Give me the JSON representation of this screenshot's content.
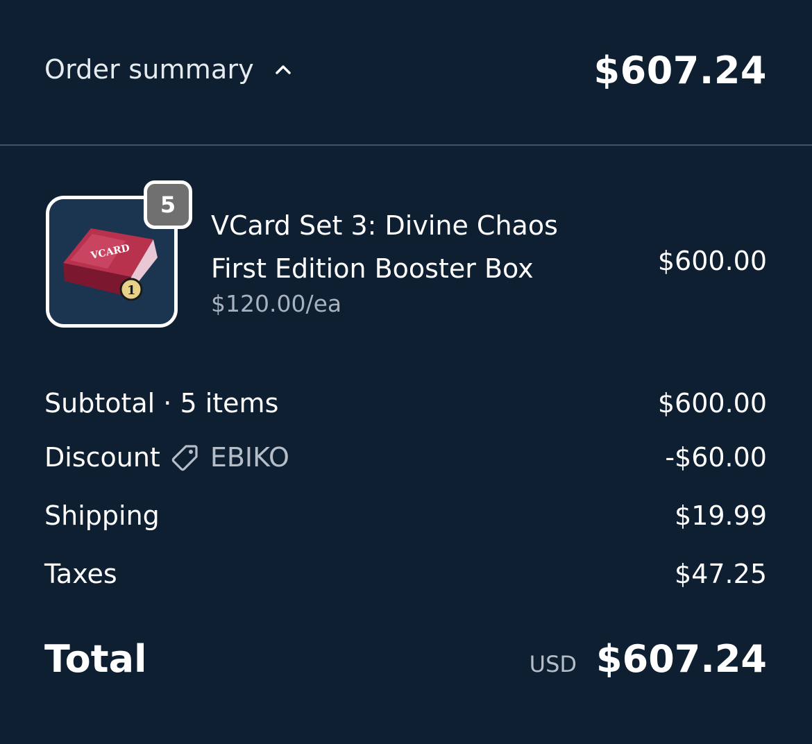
{
  "header": {
    "summary_label": "Order summary",
    "total": "$607.24"
  },
  "item": {
    "quantity": "5",
    "title_line1": "VCard Set 3: Divine Chaos",
    "title_line2": "First Edition Booster Box",
    "unit_price": "$120.00/ea",
    "line_price": "$600.00",
    "image_text": "VCARD"
  },
  "summary": {
    "subtotal_label": "Subtotal · 5 items",
    "subtotal_value": "$600.00",
    "discount_label": "Discount",
    "discount_code": "EBIKO",
    "discount_value": "-$60.00",
    "shipping_label": "Shipping",
    "shipping_value": "$19.99",
    "taxes_label": "Taxes",
    "taxes_value": "$47.25"
  },
  "total": {
    "label": "Total",
    "currency": "USD",
    "value": "$607.24"
  },
  "colors": {
    "background": "#0e1f31",
    "divider": "#43536a",
    "muted_text": "#a8b2be",
    "badge": "#707070"
  },
  "icons": {
    "toggle": "chevron-up-icon",
    "discount": "tag-icon"
  }
}
